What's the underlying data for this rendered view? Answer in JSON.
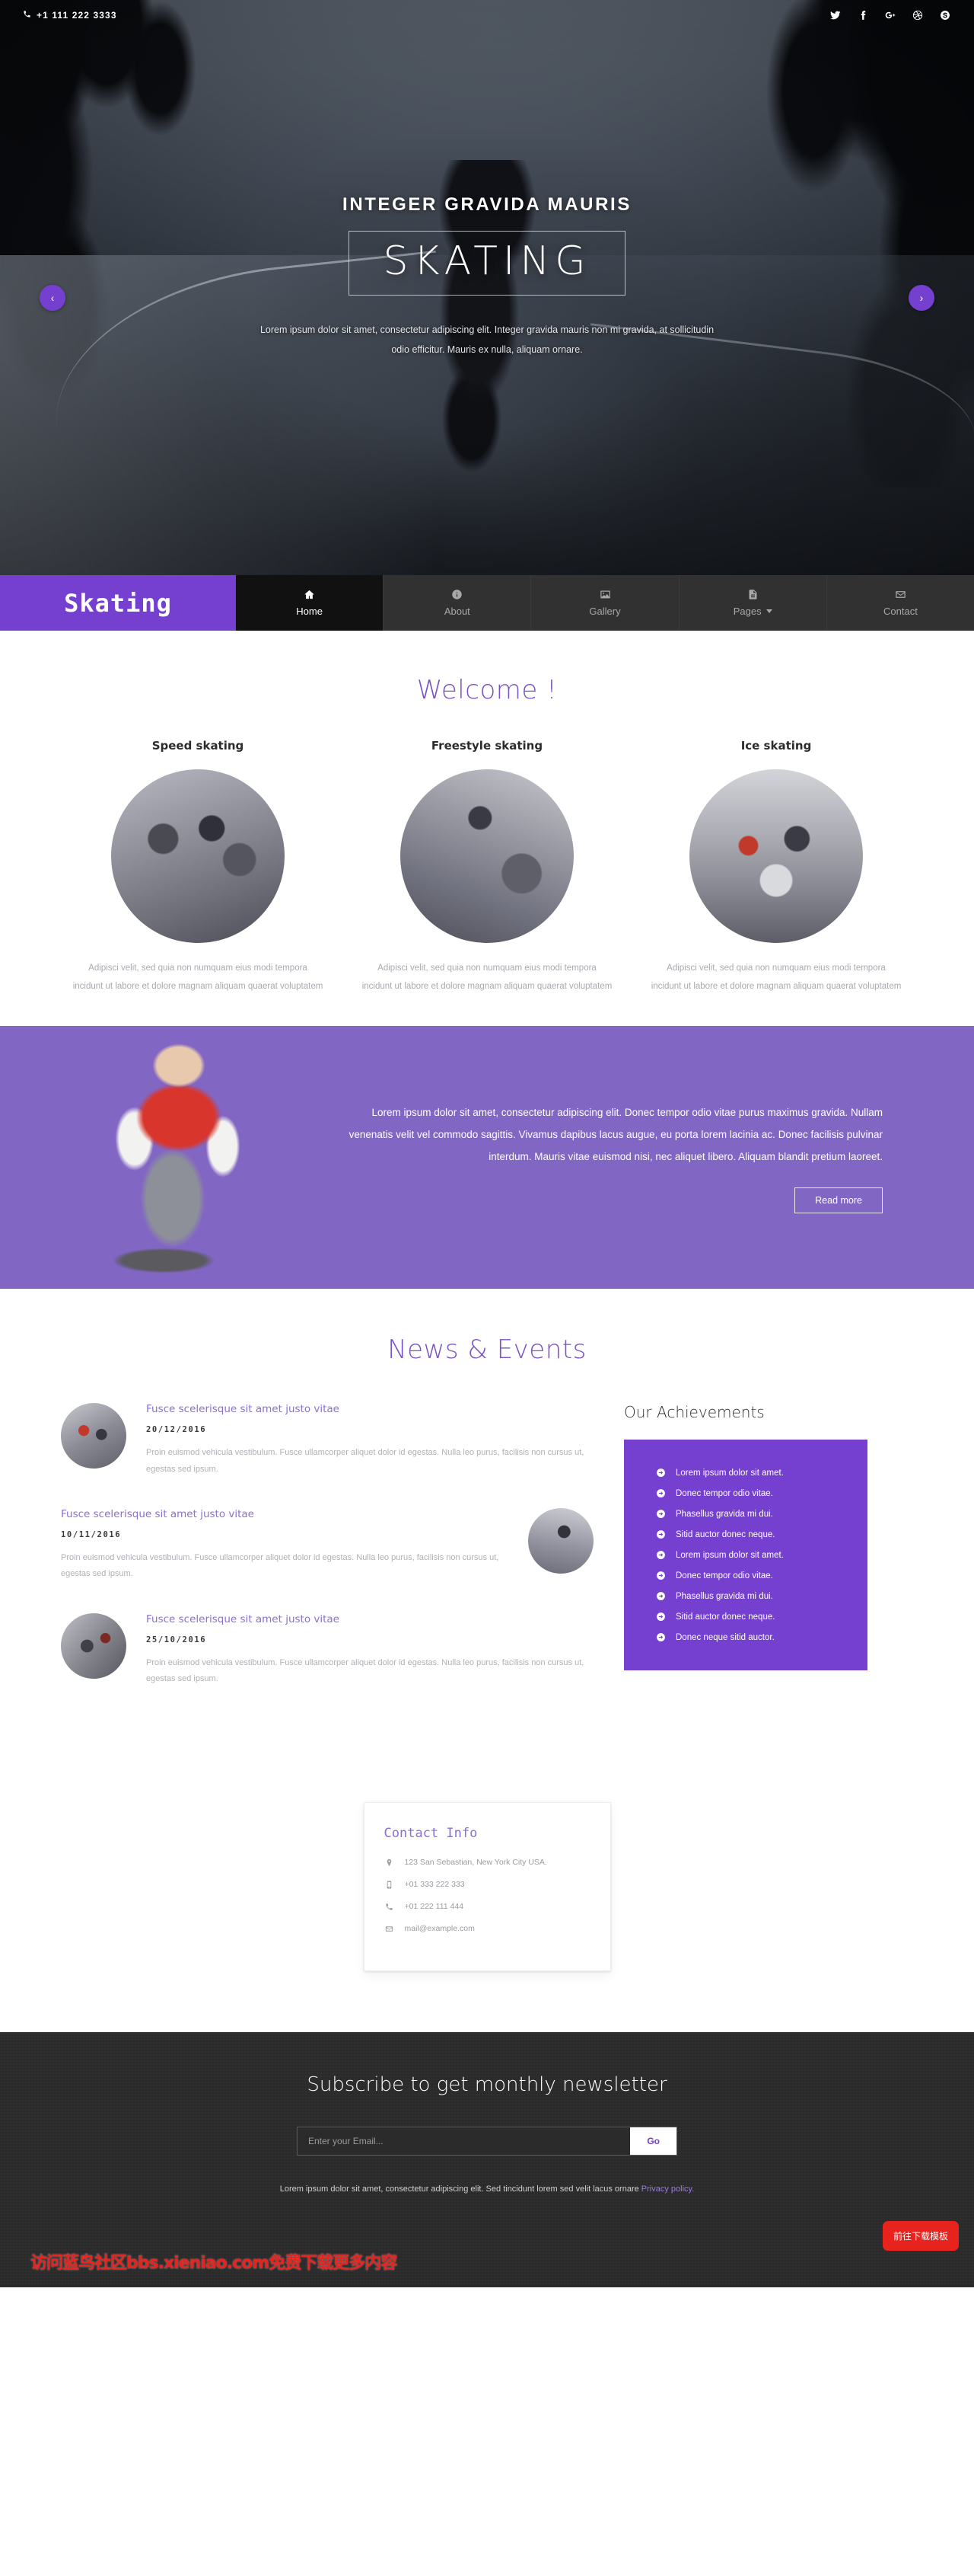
{
  "topbar": {
    "phone": "+1 111 222 3333",
    "phone_icon": "phone-icon",
    "social": [
      {
        "name": "twitter-icon",
        "label": "Twitter"
      },
      {
        "name": "facebook-icon",
        "label": "Facebook"
      },
      {
        "name": "google-plus-icon",
        "label": "Google Plus"
      },
      {
        "name": "dribbble-icon",
        "label": "Dribbble"
      },
      {
        "name": "skype-icon",
        "label": "Skype"
      }
    ]
  },
  "hero": {
    "subtitle": "INTEGER GRAVIDA MAURIS",
    "title": "SKATING",
    "paragraph": "Lorem ipsum dolor sit amet, consectetur adipiscing elit. Integer gravida mauris non mi gravida, at sollicitudin odio efficitur. Mauris ex nulla, aliquam ornare.",
    "prev_label": "‹",
    "next_label": "›",
    "accent_color": "#7540cf"
  },
  "nav": {
    "logo": "Skating",
    "items": [
      {
        "label": "Home",
        "icon": "home-icon",
        "active": true,
        "caret": false
      },
      {
        "label": "About",
        "icon": "info-icon",
        "active": false,
        "caret": false
      },
      {
        "label": "Gallery",
        "icon": "image-icon",
        "active": false,
        "caret": false
      },
      {
        "label": "Pages",
        "icon": "document-icon",
        "active": false,
        "caret": true
      },
      {
        "label": "Contact",
        "icon": "envelope-icon",
        "active": false,
        "caret": false
      }
    ]
  },
  "welcome": {
    "title": "Welcome !",
    "cards": [
      {
        "title": "Speed skating",
        "text": "Adipisci velit, sed quia non numquam eius modi tempora incidunt ut labore et dolore magnam aliquam quaerat voluptatem"
      },
      {
        "title": "Freestyle skating",
        "text": "Adipisci velit, sed quia non numquam eius modi tempora incidunt ut labore et dolore magnam aliquam quaerat voluptatem"
      },
      {
        "title": "Ice skating",
        "text": "Adipisci velit, sed quia non numquam eius modi tempora incidunt ut labore et dolore magnam aliquam quaerat voluptatem"
      }
    ]
  },
  "promo": {
    "paragraph": "Lorem ipsum dolor sit amet, consectetur adipiscing elit. Donec tempor odio vitae purus maximus gravida. Nullam venenatis velit vel commodo sagittis. Vivamus dapibus lacus augue, eu porta lorem lacinia ac. Donec facilisis pulvinar interdum. Mauris vitae euismod nisi, nec aliquet libero. Aliquam blandit pretium laoreet.",
    "button": "Read more",
    "background_color": "#8266c4"
  },
  "news": {
    "title": "News & Events",
    "items": [
      {
        "heading": "Fusce scelerisque sit amet justo vitae",
        "date": "20/12/2016",
        "text": "Proin euismod vehicula vestibulum. Fusce ullamcorper aliquet dolor id egestas. Nulla leo purus, facilisis non cursus ut, egestas sed ipsum."
      },
      {
        "heading": "Fusce scelerisque sit amet justo vitae",
        "date": "10/11/2016",
        "text": "Proin euismod vehicula vestibulum. Fusce ullamcorper aliquet dolor id egestas. Nulla leo purus, facilisis non cursus ut, egestas sed ipsum."
      },
      {
        "heading": "Fusce scelerisque sit amet justo vitae",
        "date": "25/10/2016",
        "text": "Proin euismod vehicula vestibulum. Fusce ullamcorper aliquet dolor id egestas. Nulla leo purus, facilisis non cursus ut, egestas sed ipsum."
      }
    ],
    "achievements_title": "Our Achievements",
    "achievements": [
      "Lorem ipsum dolor sit amet.",
      "Donec tempor odio vitae.",
      "Phasellus gravida mi dui.",
      "Sitid auctor donec neque.",
      "Lorem ipsum dolor sit amet.",
      "Donec tempor odio vitae.",
      "Phasellus gravida mi dui.",
      "Sitid auctor donec neque.",
      "Donec neque sitid auctor."
    ]
  },
  "contact": {
    "title": "Contact Info",
    "rows": [
      {
        "icon": "location-pin-icon",
        "value": "123 San Sebastian, New York City USA."
      },
      {
        "icon": "mobile-icon",
        "value": "+01 333 222 333"
      },
      {
        "icon": "phone-icon",
        "value": "+01 222 111 444"
      },
      {
        "icon": "envelope-icon",
        "value": "mail@example.com"
      }
    ]
  },
  "footer": {
    "heading": "Subscribe to get monthly newsletter",
    "email_placeholder": "Enter your Email...",
    "email_value": "",
    "go_label": "Go",
    "note_text": "Lorem ipsum dolor sit amet, consectetur adipiscing elit. Sed tincidunt lorem sed velit lacus ornare ",
    "note_link": "Privacy policy.",
    "watermark_button": "前往下载模板",
    "watermark_text": "访问蓝鸟社区bbs.xieniao.com免费下载更多内容"
  }
}
